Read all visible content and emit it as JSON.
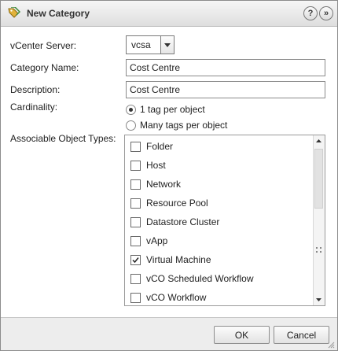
{
  "dialog": {
    "title": "New Category",
    "icon": "tag-category-icon",
    "help_label": "?",
    "close_label": "»"
  },
  "form": {
    "vcenter_label": "vCenter Server:",
    "vcenter_value": "vcsa",
    "category_name_label": "Category Name:",
    "category_name_value": "Cost Centre",
    "description_label": "Description:",
    "description_value": "Cost Centre",
    "cardinality_label": "Cardinality:",
    "cardinality_options": [
      {
        "label": "1 tag per object",
        "selected": true
      },
      {
        "label": "Many tags per object",
        "selected": false
      }
    ],
    "object_types_label": "Associable Object Types:",
    "object_types": [
      {
        "label": "Folder",
        "checked": false
      },
      {
        "label": "Host",
        "checked": false
      },
      {
        "label": "Network",
        "checked": false
      },
      {
        "label": "Resource Pool",
        "checked": false
      },
      {
        "label": "Datastore Cluster",
        "checked": false
      },
      {
        "label": "vApp",
        "checked": false
      },
      {
        "label": "Virtual Machine",
        "checked": true
      },
      {
        "label": "vCO Scheduled Workflow",
        "checked": false
      },
      {
        "label": "vCO Workflow",
        "checked": false
      }
    ]
  },
  "footer": {
    "ok_label": "OK",
    "cancel_label": "Cancel"
  }
}
